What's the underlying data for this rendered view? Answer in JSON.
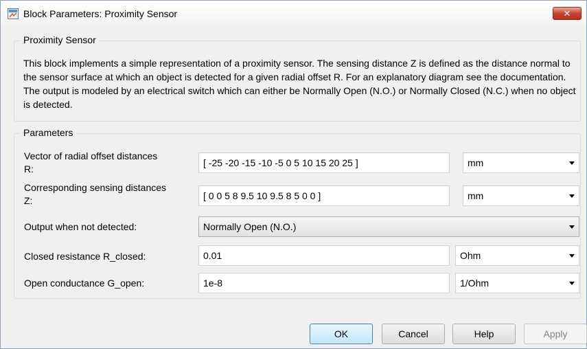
{
  "window": {
    "title": "Block Parameters: Proximity Sensor",
    "close_label": "✕"
  },
  "block": {
    "group_title": "Proximity Sensor",
    "description": "This block implements a simple representation of a proximity sensor. The sensing distance Z is defined as the distance normal to the sensor surface at which an object is detected for a given radial offset R. For an explanatory diagram see the documentation. The output is modeled by an electrical switch which can either be Normally Open (N.O.) or Normally Closed (N.C.) when no object is detected."
  },
  "parameters": {
    "group_title": "Parameters",
    "radial_offset": {
      "label_line1": "Vector of radial offset distances",
      "label_line2": "R:",
      "value": "[ -25 -20 -15 -10 -5 0 5 10 15 20 25 ]",
      "unit": "mm"
    },
    "sensing_distance": {
      "label_line1": "Corresponding sensing distances",
      "label_line2": "Z:",
      "value": "[ 0 0 5 8 9.5 10 9.5 8 5 0 0 ]",
      "unit": "mm"
    },
    "output_not_detected": {
      "label": "Output when not detected:",
      "value": "Normally Open (N.O.)"
    },
    "closed_resistance": {
      "label": "Closed resistance R_closed:",
      "value": "0.01",
      "unit": "Ohm"
    },
    "open_conductance": {
      "label": "Open conductance G_open:",
      "value": "1e-8",
      "unit": "1/Ohm"
    }
  },
  "buttons": {
    "ok": "OK",
    "cancel": "Cancel",
    "help": "Help",
    "apply": "Apply"
  },
  "icons": {
    "app": "simulink-block-icon",
    "close": "close-icon",
    "dropdown": "chevron-down-icon"
  }
}
